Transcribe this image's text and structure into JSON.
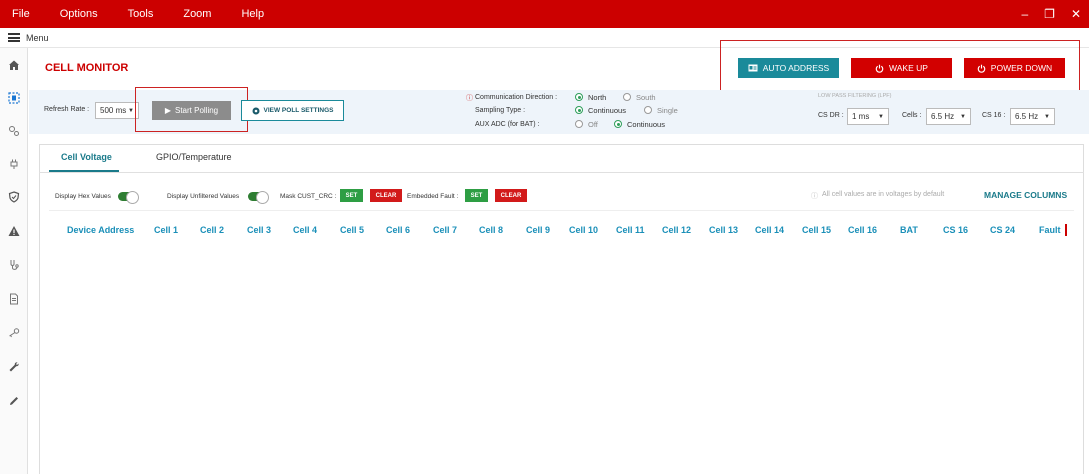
{
  "menu": [
    "File",
    "Options",
    "Tools",
    "Zoom",
    "Help"
  ],
  "window_controls": {
    "minimize": "–",
    "restore": "❐",
    "close": "✕"
  },
  "subbar": {
    "label": "Menu"
  },
  "page": {
    "title": "CELL MONITOR"
  },
  "header_buttons": {
    "auto_address": "AUTO ADDRESS",
    "wake_up": "WAKE UP",
    "power_down": "POWER DOWN"
  },
  "controls": {
    "refresh_rate_label": "Refresh Rate :",
    "refresh_rate_value": "500 ms",
    "start_polling": "Start Polling",
    "view_poll_settings": "VIEW POLL SETTINGS",
    "comm_direction_label": "Communication Direction :",
    "comm_direction_options": [
      "North",
      "South"
    ],
    "sampling_type_label": "Sampling Type :",
    "sampling_type_options": [
      "Continuous",
      "Single"
    ],
    "aux_adc_label": "AUX ADC (for BAT) :",
    "aux_adc_options": [
      "Off",
      "Continuous"
    ],
    "lpf_title": "LOW PASS FILTERING (LPF)",
    "cs_dr_label": "CS DR :",
    "cs_dr_value": "1 ms",
    "cells_label": "Cells :",
    "cells_value": "6.5 Hz",
    "cs16_label": "CS 16 :",
    "cs16_value": "6.5 Hz"
  },
  "tabs": [
    "Cell Voltage",
    "GPIO/Temperature"
  ],
  "options_row": {
    "display_hex": "Display Hex Values",
    "display_unfiltered": "Display Unfiltered Values",
    "mask_crc": "Mask CUST_CRC :",
    "embedded_fault": "Embedded Fault :",
    "set": "SET",
    "clear": "CLEAR",
    "info_note": "All cell values are in voltages by default",
    "manage_columns": "MANAGE COLUMNS"
  },
  "columns": [
    "Device Address",
    "Cell 1",
    "Cell 2",
    "Cell 3",
    "Cell 4",
    "Cell 5",
    "Cell 6",
    "Cell 7",
    "Cell 8",
    "Cell 9",
    "Cell 10",
    "Cell 11",
    "Cell 12",
    "Cell 13",
    "Cell 14",
    "Cell 15",
    "Cell 16",
    "BAT",
    "CS 16",
    "CS 24",
    "Fault"
  ],
  "colors": {
    "title_bar": "#cc0000",
    "accent_teal": "#1a8a9a",
    "column_header": "#1a8fb8",
    "danger": "#d20000",
    "success": "#2e9e44"
  }
}
